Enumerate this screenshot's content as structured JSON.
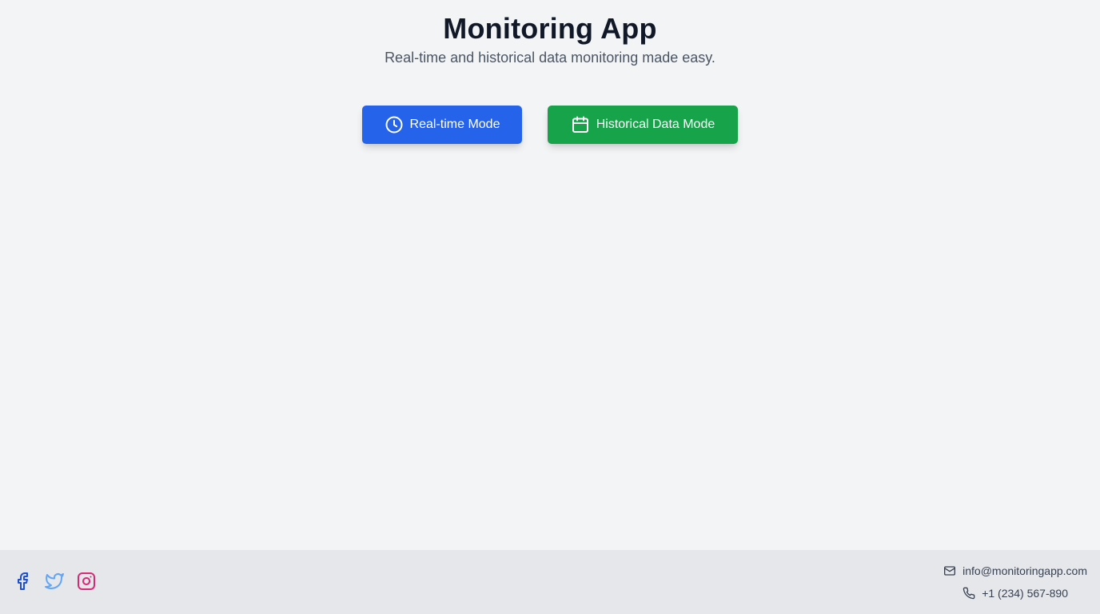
{
  "header": {
    "title": "Monitoring App",
    "subtitle": "Real-time and historical data monitoring made easy."
  },
  "actions": {
    "realtime": {
      "label": "Real-time Mode",
      "icon": "clock-icon",
      "color": "#2563eb"
    },
    "historical": {
      "label": "Historical Data Mode",
      "icon": "calendar-icon",
      "color": "#16a34a"
    }
  },
  "footer": {
    "social": [
      {
        "name": "facebook-icon",
        "color": "#1d4ed8"
      },
      {
        "name": "twitter-icon",
        "color": "#60a5fa"
      },
      {
        "name": "instagram-icon",
        "color": "#db2777"
      }
    ],
    "contact": {
      "email": "info@monitoringapp.com",
      "phone": "+1 (234) 567-890"
    }
  }
}
